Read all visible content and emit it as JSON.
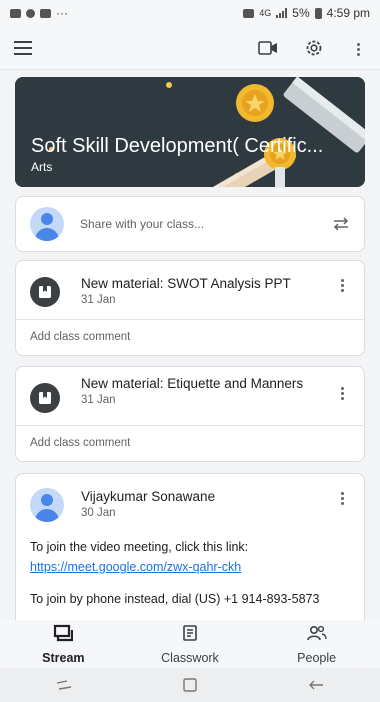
{
  "status_bar": {
    "battery": "5%",
    "time": "4:59 pm",
    "network": "4G",
    "ellipsis": "···"
  },
  "toolbar": {
    "menu_icon": "menu-icon",
    "video_icon": "video-call-icon",
    "settings_icon": "settings-icon",
    "more_icon": "more-vert-icon"
  },
  "banner": {
    "title": "Soft Skill Development( Certific...",
    "subtitle": "Arts",
    "color": "#2f3a40"
  },
  "share": {
    "placeholder": "Share with your class..."
  },
  "posts": [
    {
      "title": "New material: SWOT Analysis PPT",
      "date": "31 Jan",
      "comment": "Add class comment"
    },
    {
      "title": "New material: Etiquette and Manners",
      "date": "31 Jan",
      "comment": "Add class comment"
    }
  ],
  "announcement": {
    "author": "Vijaykumar Sonawane",
    "date": "30 Jan",
    "line1": "To join the video meeting, click this link:",
    "link": "https://meet.google.com/zwx-qahr-ckh",
    "line2": "To join by phone instead, dial (US) +1 914-893-5873"
  },
  "bottom_nav": {
    "items": [
      {
        "label": "Stream",
        "icon": "stream-icon",
        "active": true
      },
      {
        "label": "Classwork",
        "icon": "classwork-icon",
        "active": false
      },
      {
        "label": "People",
        "icon": "people-icon",
        "active": false
      }
    ]
  },
  "colors": {
    "accent": "#1a73e8",
    "avatar": "#4a86e8"
  }
}
